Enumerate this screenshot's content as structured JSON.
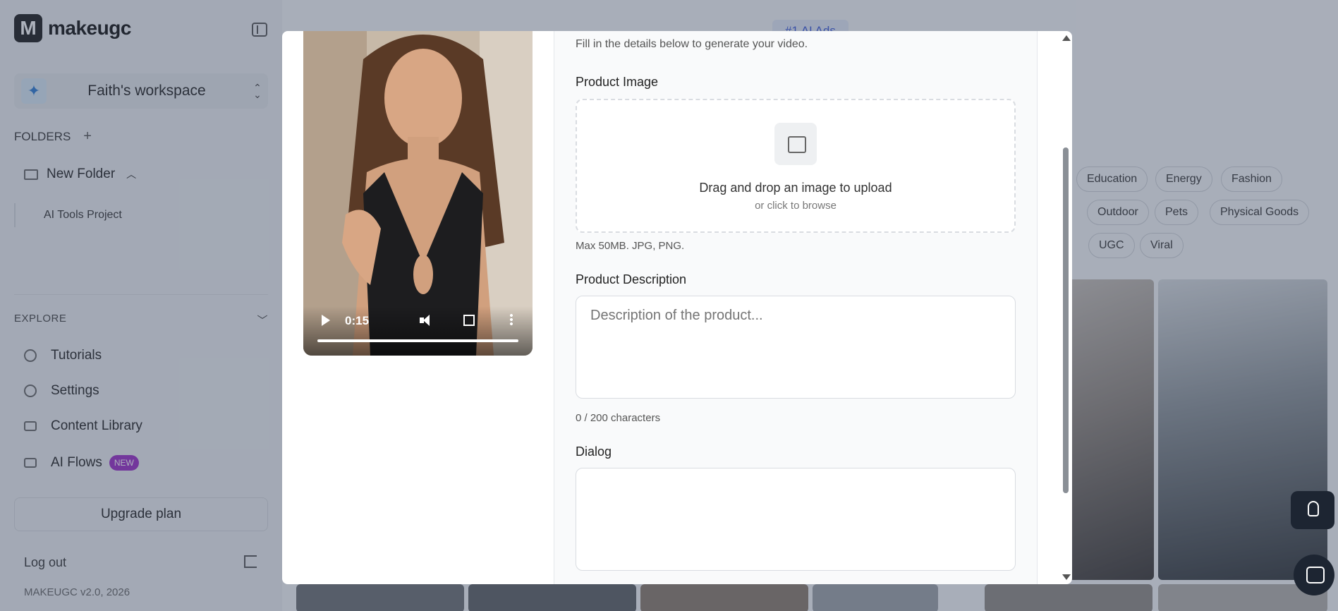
{
  "app": {
    "logo_letter": "M",
    "name": "makeugc"
  },
  "workspace": {
    "name": "Faith's workspace"
  },
  "folders": {
    "heading": "FOLDERS",
    "items": [
      {
        "label": "New Folder",
        "children": [
          "AI Tools Project"
        ]
      }
    ]
  },
  "explore": {
    "heading": "EXPLORE",
    "items": [
      {
        "label": "Tutorials",
        "icon": "play-circle-icon"
      },
      {
        "label": "Settings",
        "icon": "gear-icon"
      },
      {
        "label": "Content Library",
        "icon": "folder-icon"
      },
      {
        "label": "AI Flows",
        "icon": "flow-icon",
        "badge": "NEW"
      }
    ]
  },
  "footer": {
    "upgrade": "Upgrade plan",
    "logout": "Log out",
    "version": "MAKEUGC v2.0, 2026"
  },
  "background": {
    "top_pill": "#1 AI Ads",
    "tags_row1": [
      "Education",
      "Energy",
      "Fashion"
    ],
    "tags_row2": [
      "Outdoor",
      "Pets",
      "Physical Goods"
    ],
    "tags_row3": [
      "UGC",
      "Viral"
    ]
  },
  "video": {
    "time": "0:15",
    "progress_fraction": 1.0
  },
  "form": {
    "subtitle": "Fill in the details below to generate your video.",
    "product_image_label": "Product Image",
    "upload_main": "Drag and drop an image to upload",
    "upload_sub": "or click to browse",
    "upload_hint": "Max 50MB. JPG, PNG.",
    "description_label": "Product Description",
    "description_placeholder": "Description of the product...",
    "description_count": "0 / 200 characters",
    "dialog_label": "Dialog",
    "dialog_value": ""
  },
  "colors": {
    "accent": "#3b5bdb",
    "new_badge": "#9b2cc8",
    "dark_button": "#1d2532"
  }
}
